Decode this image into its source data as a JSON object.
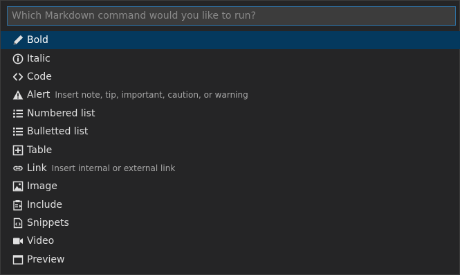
{
  "search": {
    "placeholder": "Which Markdown command would you like to run?",
    "value": ""
  },
  "colors": {
    "selected_background": "#04395e",
    "input_border": "#2f6f9f",
    "panel_background": "#252526"
  },
  "items": [
    {
      "label": "Bold",
      "description": "",
      "icon": "pencil-icon",
      "selected": true
    },
    {
      "label": "Italic",
      "description": "",
      "icon": "info-circle-icon",
      "selected": false
    },
    {
      "label": "Code",
      "description": "",
      "icon": "code-brackets-icon",
      "selected": false
    },
    {
      "label": "Alert",
      "description": "Insert note, tip, important, caution, or warning",
      "icon": "warning-triangle-icon",
      "selected": false
    },
    {
      "label": "Numbered list",
      "description": "",
      "icon": "numbered-list-icon",
      "selected": false
    },
    {
      "label": "Bulletted list",
      "description": "",
      "icon": "bulleted-list-icon",
      "selected": false
    },
    {
      "label": "Table",
      "description": "",
      "icon": "table-plus-icon",
      "selected": false
    },
    {
      "label": "Link",
      "description": "Insert internal or external link",
      "icon": "link-icon",
      "selected": false
    },
    {
      "label": "Image",
      "description": "",
      "icon": "image-icon",
      "selected": false
    },
    {
      "label": "Include",
      "description": "",
      "icon": "include-clipboard-icon",
      "selected": false
    },
    {
      "label": "Snippets",
      "description": "",
      "icon": "snippet-file-icon",
      "selected": false
    },
    {
      "label": "Video",
      "description": "",
      "icon": "video-camera-icon",
      "selected": false
    },
    {
      "label": "Preview",
      "description": "",
      "icon": "preview-window-icon",
      "selected": false
    }
  ]
}
